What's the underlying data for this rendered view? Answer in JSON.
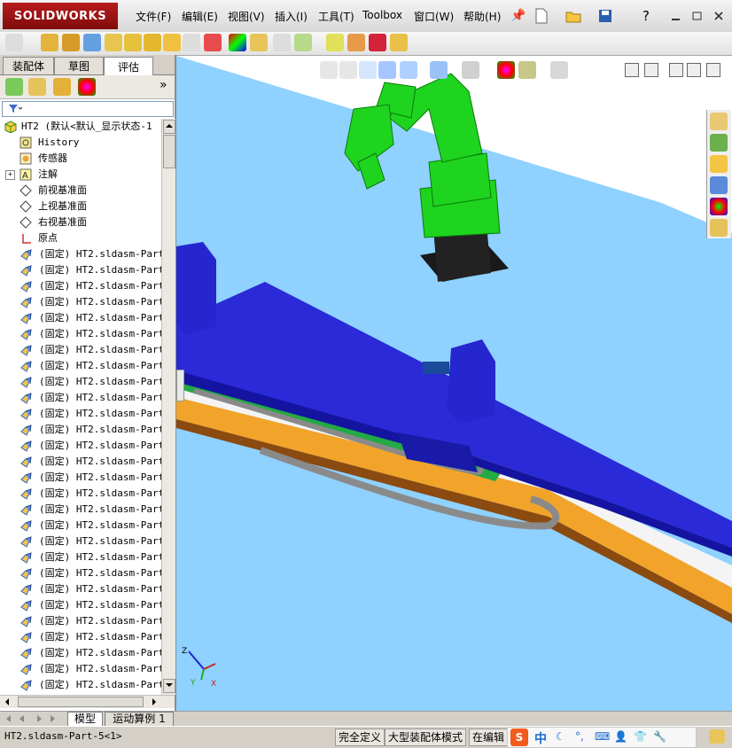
{
  "app": {
    "name": "SOLIDWORKS",
    "menus": [
      "文件(F)",
      "编辑(E)",
      "视图(V)",
      "插入(I)",
      "工具(T)",
      "Toolbox",
      "窗口(W)",
      "帮助(H)"
    ]
  },
  "panel": {
    "tabs": [
      "装配体",
      "草图",
      "评估"
    ],
    "expand_glyph": "»",
    "root_label": "HT2 (默认<默认_显示状态-1",
    "items": [
      {
        "label": "History",
        "icon": "history-icon"
      },
      {
        "label": "传感器",
        "icon": "sensor-icon"
      },
      {
        "label": "注解",
        "icon": "annotation-icon"
      },
      {
        "label": "前视基准面",
        "icon": "plane-icon"
      },
      {
        "label": "上视基准面",
        "icon": "plane-icon"
      },
      {
        "label": "右视基准面",
        "icon": "plane-icon"
      },
      {
        "label": "原点",
        "icon": "origin-icon"
      }
    ],
    "part_label": "(固定) HT2.sldasm-Part-",
    "part_count": 29
  },
  "bottom_tabs": [
    "模型",
    "运动算例 1"
  ],
  "status": {
    "left": "HT2.sldasm-Part-5<1>",
    "fully_defined": "完全定义",
    "large_assembly": "大型装配体模式",
    "editing": "在编辑"
  },
  "ime": {
    "brand": "S",
    "mode": "中"
  },
  "triad": {
    "z": "Z",
    "y": "Y",
    "x": "X"
  },
  "colors": {
    "brand_red": "#b71c1c",
    "robot_green": "#1ed41e",
    "rail_blue": "#2222d6",
    "base_orange": "#f2a42a",
    "viewport_bg": "#8fd1ff"
  }
}
